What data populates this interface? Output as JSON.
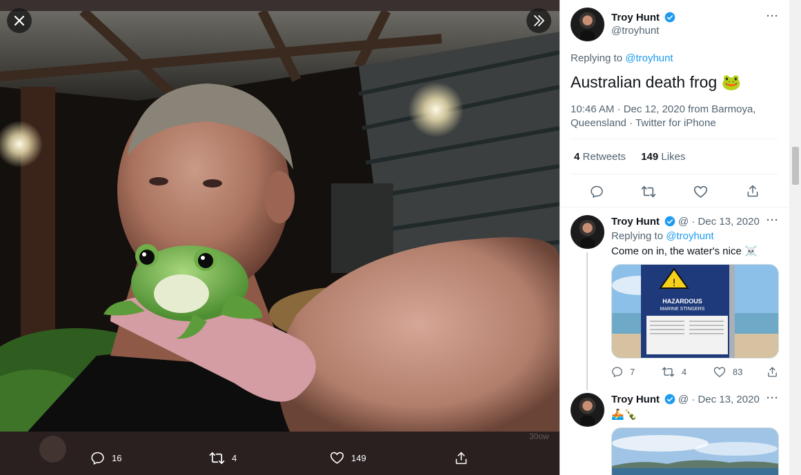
{
  "viewer": {
    "close_icon": "close-icon",
    "expand_icon": "chevrons-right-icon",
    "actions": {
      "replies": "16",
      "retweets": "4",
      "likes": "149"
    },
    "ghost_text": "30ow"
  },
  "main_tweet": {
    "name": "Troy Hunt",
    "handle": "@troyhunt",
    "replying_label": "Replying to",
    "replying_to": "@troyhunt",
    "text": "Australian death frog",
    "emoji": "🐸",
    "meta_line1": "10:46 AM · Dec 12, 2020 from Barmoya,",
    "meta_line2": "Queensland · Twitter for iPhone",
    "retweets_count": "4",
    "retweets_label": "Retweets",
    "likes_count": "149",
    "likes_label": "Likes"
  },
  "reply1": {
    "name": "Troy Hunt",
    "handle_date": "@ · Dec 13, 2020",
    "replying_label": "Replying to",
    "replying_to": "@troyhunt",
    "text": "Come on in, the water's nice ☠️",
    "sign_title": "HAZARDOUS",
    "sign_subtitle": "MARINE STINGERS",
    "replies": "7",
    "retweets": "4",
    "likes": "83"
  },
  "reply2": {
    "name": "Troy Hunt",
    "handle_date": "@ · Dec 13, 2020",
    "text": "🚣🍾"
  },
  "colors": {
    "accent": "#1d9bf0",
    "verified": "#1d9bf0",
    "text_primary": "#0f1419",
    "text_secondary": "#536471"
  }
}
